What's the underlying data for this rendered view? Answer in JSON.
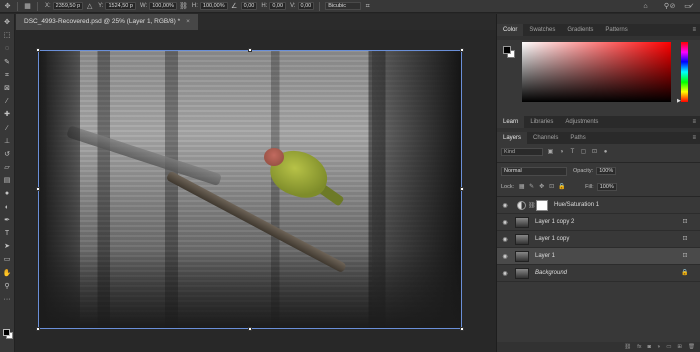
{
  "options": {
    "x_label": "X:",
    "x_value": "2359,50 p",
    "y_label": "Y:",
    "y_value": "1524,50 p",
    "w_label": "W:",
    "w_value": "100,00%",
    "h_label": "H:",
    "h_value": "100,00%",
    "angle_value": "0,00",
    "hskew_label": "H:",
    "hskew_value": "0,00",
    "vskew_label": "V:",
    "vskew_value": "0,00",
    "interpolation": "Bicubic"
  },
  "document": {
    "tab_title": "DSC_4993-Recovered.psd @ 25% (Layer 1, RGB/8) *",
    "tab_close": "×"
  },
  "color_panel": {
    "tabs": [
      "Color",
      "Swatches",
      "Gradients",
      "Patterns"
    ],
    "foreground": "#000000",
    "background": "#ffffff",
    "hue_color": "#ff0000"
  },
  "learn_panel": {
    "tabs": [
      "Learn",
      "Libraries",
      "Adjustments"
    ]
  },
  "layers_panel": {
    "tabs": [
      "Layers",
      "Channels",
      "Paths"
    ],
    "kind_placeholder": "Kind",
    "blend_mode": "Normal",
    "opacity_label": "Opacity:",
    "opacity_value": "100%",
    "lock_label": "Lock:",
    "fill_label": "Fill:",
    "fill_value": "100%",
    "layers": [
      {
        "name": "Hue/Saturation 1",
        "type": "adjustment",
        "selected": false
      },
      {
        "name": "Layer 1 copy 2",
        "type": "pixel",
        "selected": false
      },
      {
        "name": "Layer 1 copy",
        "type": "pixel",
        "selected": false
      },
      {
        "name": "Layer 1",
        "type": "pixel",
        "selected": true
      },
      {
        "name": "Background",
        "type": "background",
        "selected": false
      }
    ]
  }
}
